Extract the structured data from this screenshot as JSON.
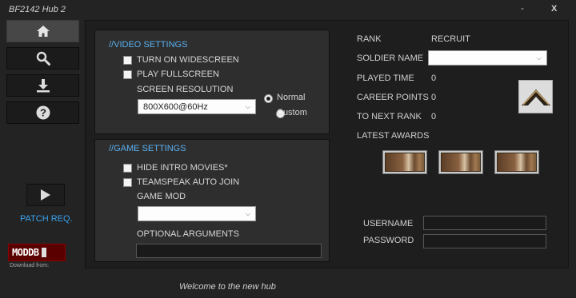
{
  "window": {
    "title": "BF2142 Hub 2",
    "minimize": "-",
    "close": "X"
  },
  "sidebar": {
    "nav": [
      {
        "icon": "home-icon"
      },
      {
        "icon": "search-icon"
      },
      {
        "icon": "download-icon"
      },
      {
        "icon": "help-icon"
      }
    ],
    "play_icon": "play-icon",
    "patch_label": "PATCH REQ.",
    "moddb_logo_text": "MODDB",
    "download_from": "Download from:"
  },
  "video": {
    "heading": "//VIDEO SETTINGS",
    "widescreen": "TURN ON WIDESCREEN",
    "fullscreen": "PLAY FULLSCREEN",
    "resolution_label": "SCREEN RESOLUTION",
    "resolution_value": "800X600@60Hz",
    "radio_normal": "Normal",
    "radio_custom": "Custom",
    "widescreen_checked": false,
    "fullscreen_checked": false,
    "selected_radio": "Normal"
  },
  "game": {
    "heading": "//GAME SETTINGS",
    "hide_intro": "HIDE INTRO MOVIES*",
    "teamspeak": "TEAMSPEAK AUTO JOIN",
    "mod_label": "GAME MOD",
    "mod_value": "",
    "args_label": "OPTIONAL ARGUMENTS",
    "args_value": "",
    "hide_intro_checked": false,
    "teamspeak_checked": false
  },
  "profile": {
    "rank_label": "RANK",
    "rank_value": "RECRUIT",
    "soldier_label": "SOLDIER NAME",
    "soldier_value": "",
    "played_label": "PLAYED TIME",
    "played_value": "0",
    "career_label": "CAREER POINTS",
    "career_value": "0",
    "next_label": "TO NEXT RANK",
    "next_value": "0",
    "awards_label": "LATEST AWARDS",
    "awards": [
      "award-1",
      "award-2",
      "award-3"
    ]
  },
  "login": {
    "username_label": "USERNAME",
    "password_label": "PASSWORD",
    "username_value": "",
    "password_value": ""
  },
  "status": {
    "text": "Welcome to the new hub"
  }
}
